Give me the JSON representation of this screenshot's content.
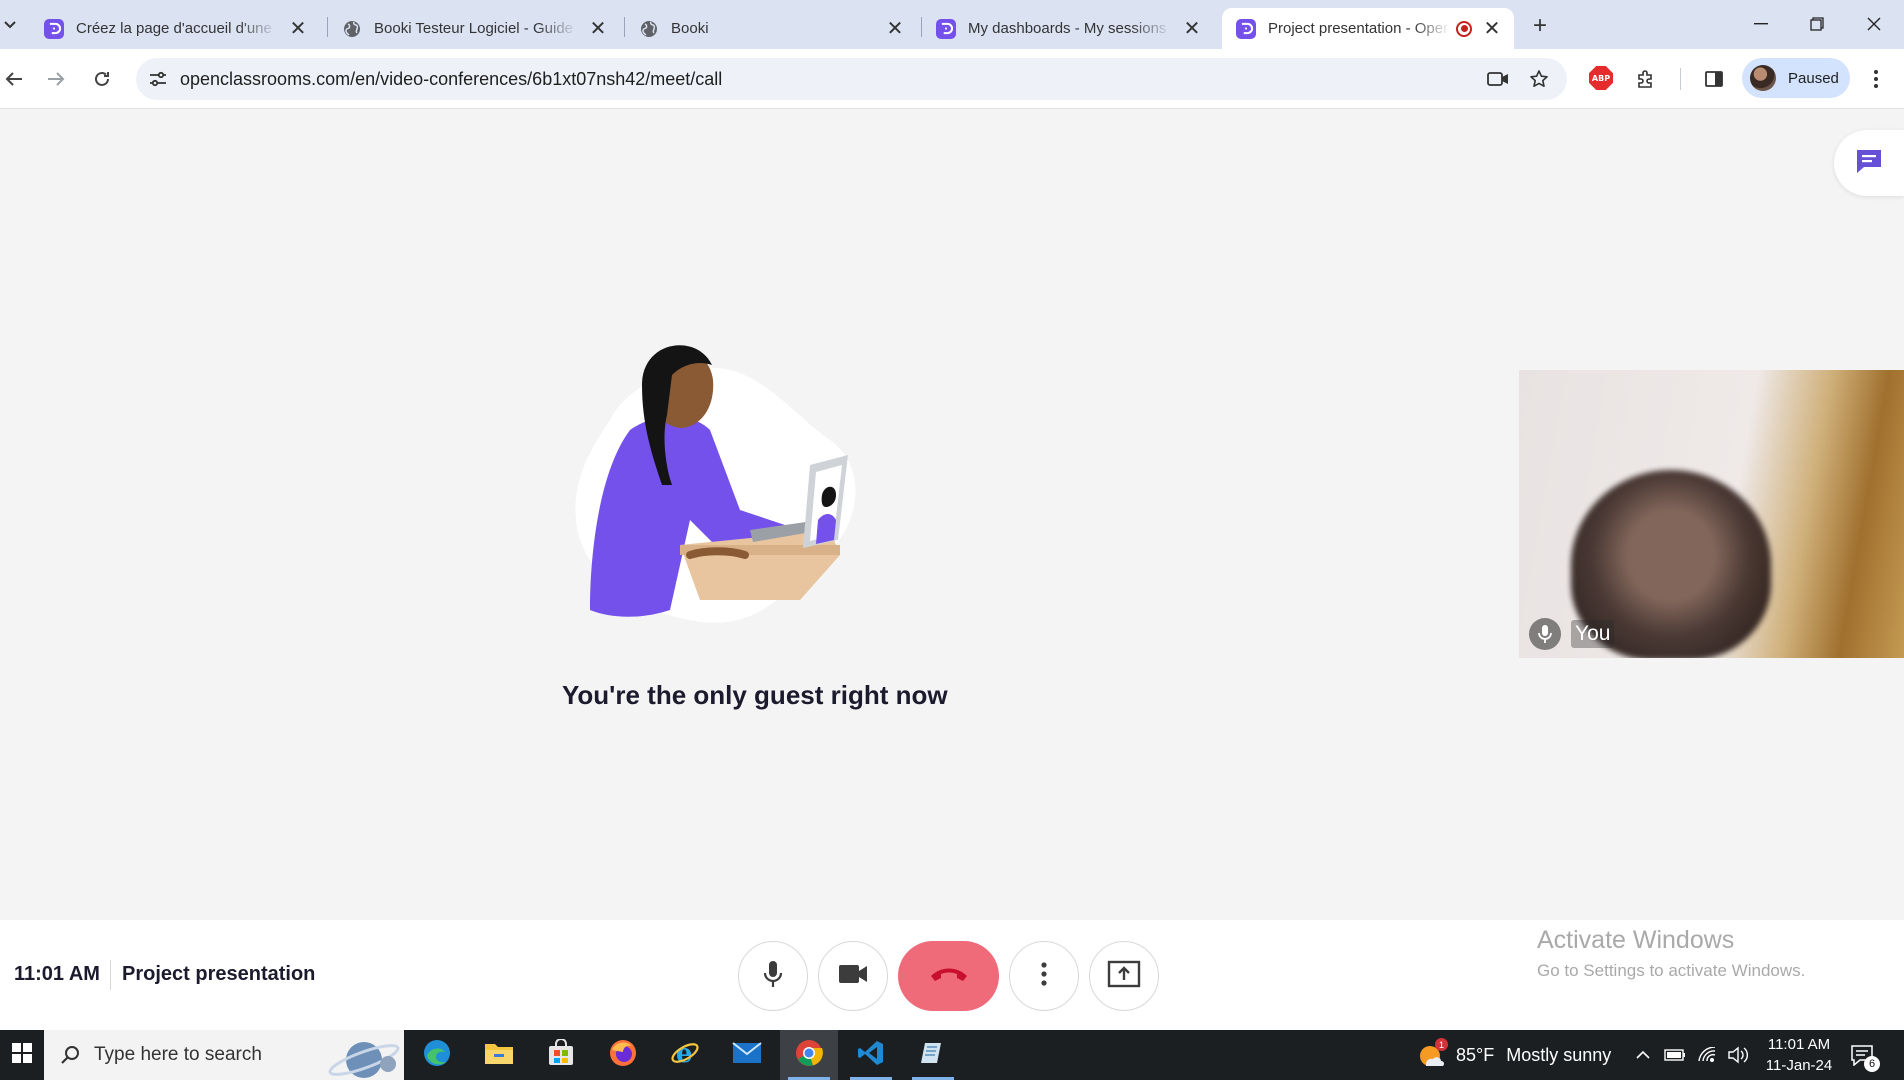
{
  "browser": {
    "tabs": [
      {
        "title": "Créez la page d'accueil d'une agence",
        "icon": "openclassrooms-icon",
        "active": false
      },
      {
        "title": "Booki Testeur Logiciel - Guide de l'étudiant",
        "icon": "globe-icon",
        "active": false
      },
      {
        "title": "Booki",
        "icon": "globe-icon",
        "active": false
      },
      {
        "title": "My dashboards - My sessions - OpenClassrooms",
        "icon": "openclassrooms-icon",
        "active": false
      },
      {
        "title": "Project presentation - OpenClassrooms",
        "icon": "openclassrooms-icon",
        "active": true,
        "recording": true
      }
    ],
    "url": "openclassrooms.com/en/video-conferences/6b1xt07nsh42/meet/call",
    "profile_label": "Paused",
    "abp_label": "ABP"
  },
  "call": {
    "empty_message": "You're the only guest right now",
    "self_view_label": "You",
    "time": "11:01 AM",
    "title": "Project presentation"
  },
  "watermark": {
    "line1": "Activate Windows",
    "line2": "Go to Settings to activate Windows."
  },
  "taskbar": {
    "search_placeholder": "Type here to search",
    "weather_temp": "85°F",
    "weather_text": "Mostly sunny",
    "weather_badge": "1",
    "clock_time": "11:01 AM",
    "clock_date": "11-Jan-24",
    "notification_count": "6"
  },
  "colors": {
    "accent": "#7451eb",
    "end_call": "#ef6b7a",
    "tabstrip": "#dbe3f3"
  }
}
